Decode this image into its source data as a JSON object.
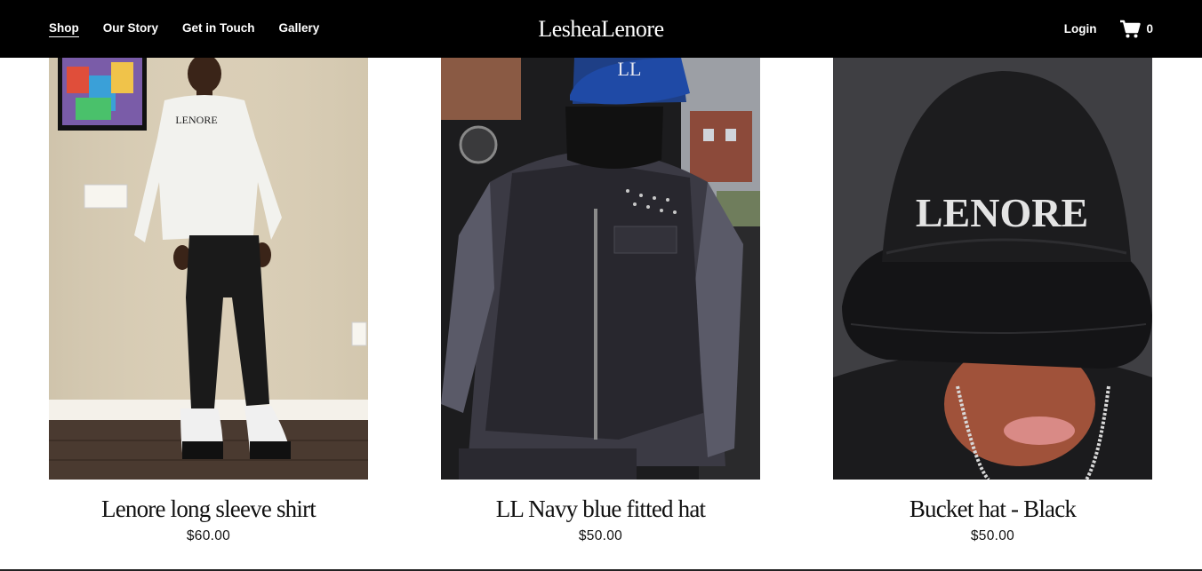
{
  "header": {
    "nav": [
      {
        "label": "Shop",
        "active": true
      },
      {
        "label": "Our Story"
      },
      {
        "label": "Get in Touch"
      },
      {
        "label": "Gallery"
      }
    ],
    "brand": "LesheaLenore",
    "login_label": "Login",
    "cart_icon": "cart-icon",
    "cart_count": "0"
  },
  "products": [
    {
      "title": "Lenore long sleeve shirt",
      "price": "$60.00",
      "shirt_text": "LENORE"
    },
    {
      "title": "LL Navy blue fitted hat",
      "price": "$50.00",
      "hat_text": "LL"
    },
    {
      "title": "Bucket hat - Black",
      "price": "$50.00",
      "hat_text": "LENORE"
    }
  ],
  "colors": {
    "header_bg": "#000000",
    "header_text": "#ffffff",
    "body_text": "#111111"
  }
}
